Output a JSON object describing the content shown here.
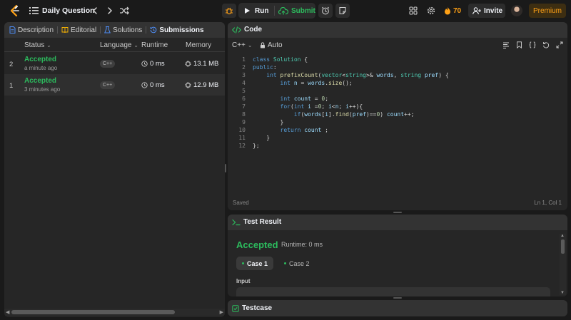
{
  "topbar": {
    "title": "Daily Question",
    "run_label": "Run",
    "submit_label": "Submit",
    "streak_count": "70",
    "invite_label": "Invite",
    "premium_label": "Premium"
  },
  "left_tabs": [
    {
      "label": "Description"
    },
    {
      "label": "Editorial"
    },
    {
      "label": "Solutions"
    },
    {
      "label": "Submissions"
    }
  ],
  "submissions": {
    "columns": [
      "Status",
      "Language",
      "Runtime",
      "Memory"
    ],
    "rows": [
      {
        "num": "2",
        "status": "Accepted",
        "time": "a minute ago",
        "lang": "C++",
        "runtime": "0 ms",
        "memory": "13.1 MB"
      },
      {
        "num": "1",
        "status": "Accepted",
        "time": "3 minutes ago",
        "lang": "C++",
        "runtime": "0 ms",
        "memory": "12.9 MB"
      }
    ]
  },
  "code": {
    "title": "Code",
    "language": "C++",
    "mode": "Auto",
    "line_numbers": [
      "1",
      "2",
      "3",
      "4",
      "5",
      "6",
      "7",
      "8",
      "9",
      "10",
      "11",
      "12"
    ],
    "status_left": "Saved",
    "status_right": "Ln 1, Col 1"
  },
  "result": {
    "title": "Test Result",
    "verdict": "Accepted",
    "runtime": "Runtime: 0 ms",
    "cases": [
      "Case 1",
      "Case 2"
    ],
    "input_label": "Input"
  },
  "testcase": {
    "title": "Testcase"
  },
  "colors": {
    "accent_green": "#2cbb5d",
    "accent_orange": "#ffa116",
    "panel_bg": "#262626",
    "page_bg": "#1a1a1a"
  }
}
